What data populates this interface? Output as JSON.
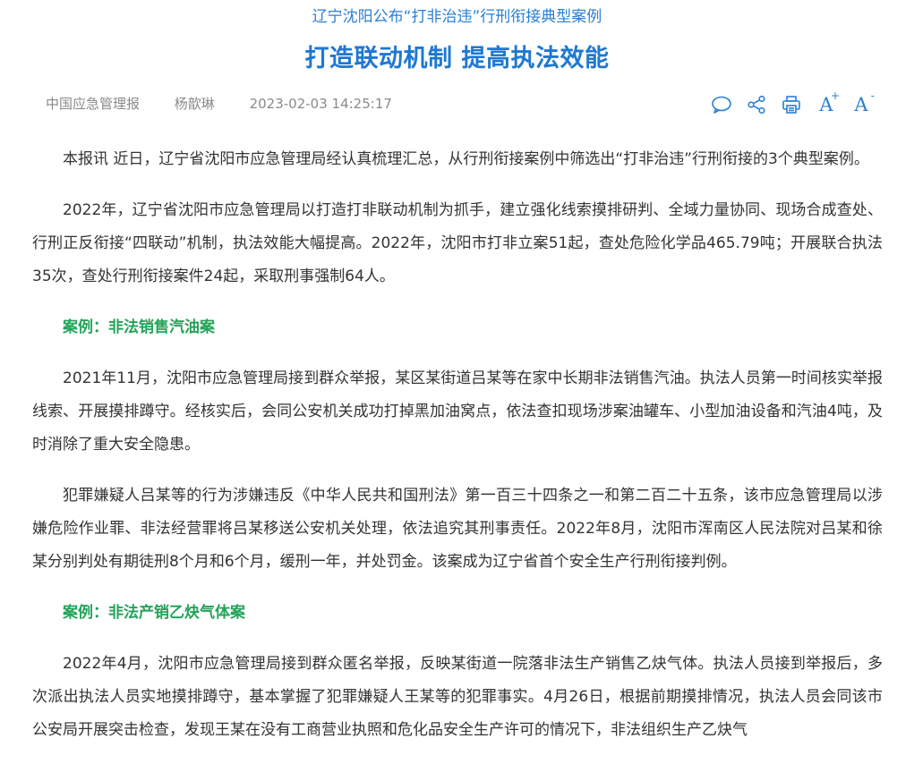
{
  "header": {
    "subtitle": "辽宁沈阳公布“打非治违”行刑衔接典型案例",
    "title": "打造联动机制 提高执法效能"
  },
  "meta": {
    "source": "中国应急管理报",
    "author": "杨歆琳",
    "datetime": "2023-02-03 14:25:17"
  },
  "toolbar": {
    "icons": [
      "comment-icon",
      "share-icon",
      "print-icon",
      "font-increase-icon",
      "font-decrease-icon"
    ],
    "font_increase_label": "A",
    "font_increase_sup": "+",
    "font_decrease_label": "A",
    "font_decrease_sup": "-"
  },
  "article": {
    "p1": "本报讯  近日，辽宁省沈阳市应急管理局经认真梳理汇总，从行刑衔接案例中筛选出“打非治违”行刑衔接的3个典型案例。",
    "p2": "2022年，辽宁省沈阳市应急管理局以打造打非联动机制为抓手，建立强化线索摸排研判、全域力量协同、现场合成查处、行刑正反衔接“四联动”机制，执法效能大幅提高。2022年，沈阳市打非立案51起，查处危险化学品465.79吨；开展联合执法35次，查处行刑衔接案件24起，采取刑事强制64人。",
    "case1_heading": "案例：非法销售汽油案",
    "p3": "2021年11月，沈阳市应急管理局接到群众举报，某区某街道吕某等在家中长期非法销售汽油。执法人员第一时间核实举报线索、开展摸排蹲守。经核实后，会同公安机关成功打掉黑加油窝点，依法查扣现场涉案油罐车、小型加油设备和汽油4吨，及时消除了重大安全隐患。",
    "p4": "犯罪嫌疑人吕某等的行为涉嫌违反《中华人民共和国刑法》第一百三十四条之一和第二百二十五条，该市应急管理局以涉嫌危险作业罪、非法经营罪将吕某移送公安机关处理，依法追究其刑事责任。2022年8月，沈阳市浑南区人民法院对吕某和徐某分别判处有期徒刑8个月和6个月，缓刑一年，并处罚金。该案成为辽宁省首个安全生产行刑衔接判例。",
    "case2_heading": "案例：非法产销乙炔气体案",
    "p5": "2022年4月，沈阳市应急管理局接到群众匿名举报，反映某街道一院落非法生产销售乙炔气体。执法人员接到举报后，多次派出执法人员实地摸排蹲守，基本掌握了犯罪嫌疑人王某等的犯罪事实。4月26日，根据前期摸排情况，执法人员会同该市公安局开展突击检查，发现王某在没有工商营业执照和危化品安全生产许可的情况下，非法组织生产乙炔气"
  },
  "colors": {
    "accent_blue": "#1e78d2",
    "case_green": "#23a35a",
    "meta_gray": "#8a8a8a",
    "body_text": "#333333"
  }
}
